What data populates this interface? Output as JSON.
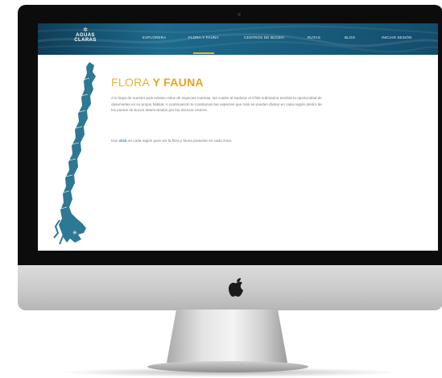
{
  "logo": {
    "line1": "AGUAS",
    "line2": "CLARAS"
  },
  "nav": {
    "items": [
      {
        "label": "EXPLÓRERA"
      },
      {
        "label": "FLORA Y FAUNA"
      },
      {
        "label": "CENTROS DE BUCEO"
      },
      {
        "label": "RUTAS"
      },
      {
        "label": "BLOG"
      },
      {
        "label": "INICIAR SESIÓN"
      }
    ]
  },
  "content": {
    "title_light": "FLORA",
    "title_bold": "Y FAUNA",
    "paragraph": "A lo largo de nuestro país existen miles de especies marinas, las cuales al explorar el Chile submarino tendrás la oportunidad de observarlas en su propio hábitat. A continuación te mostramos las especies que más se pueden divisar en cada región dentro de los puntos de buceo determinados por los mismos centros.",
    "instruction_prefix": "Haz",
    "instruction_link": "click",
    "instruction_suffix": "en cada región para ver la flora y fauna presente en cada zona."
  },
  "colors": {
    "accent": "#e9b232",
    "nav_bg": "#1d6a8c",
    "map": "#2d7894",
    "link": "#2d8ab3"
  }
}
